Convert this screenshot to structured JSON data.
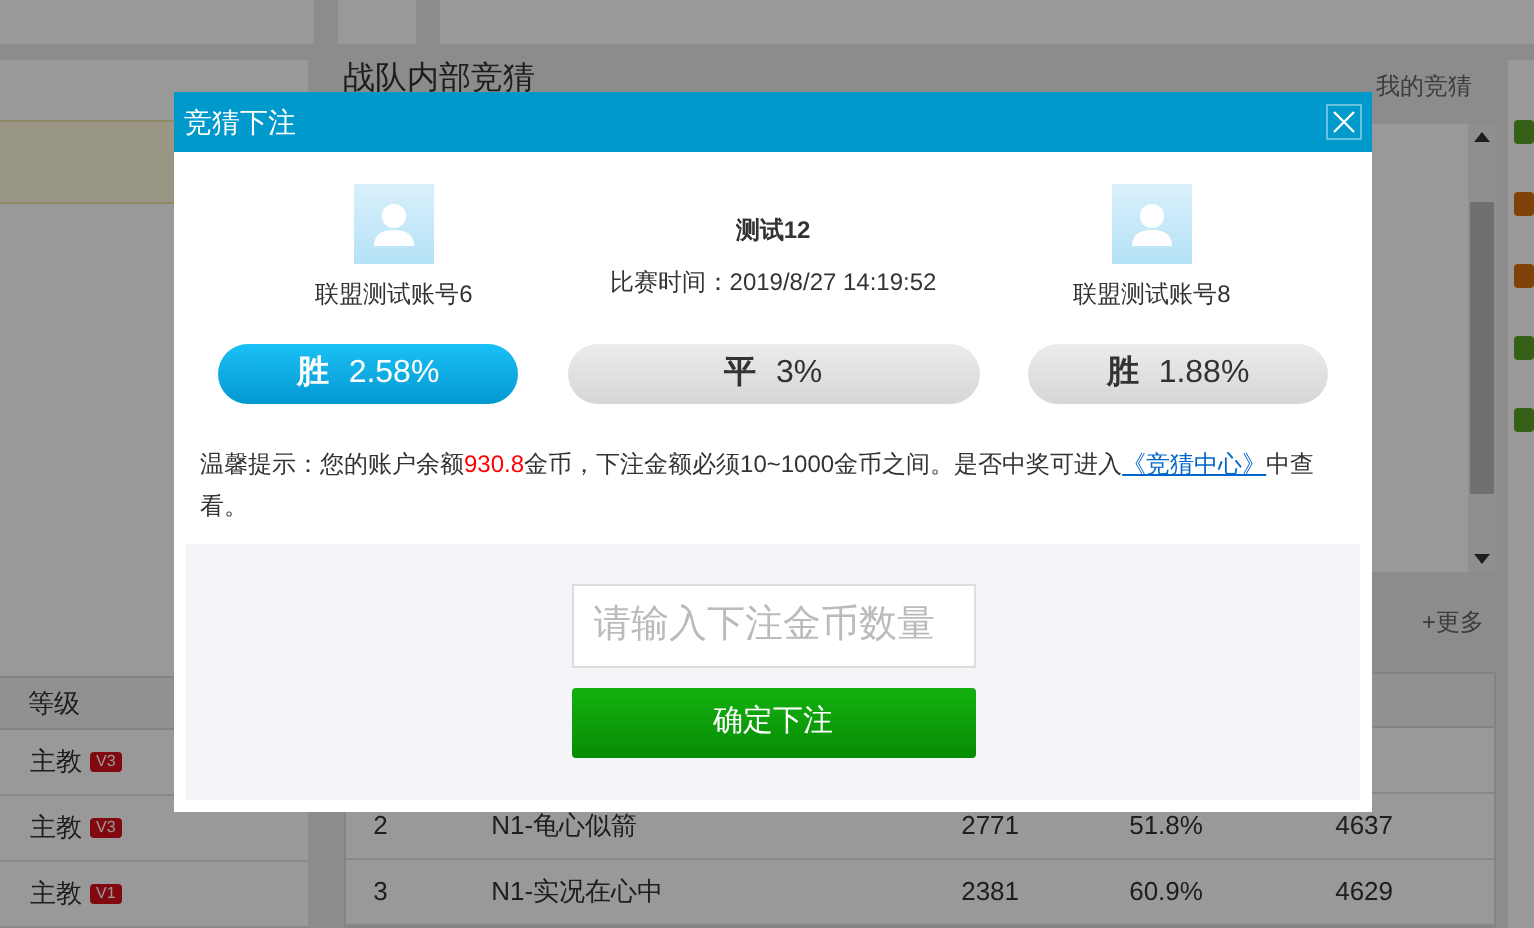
{
  "background": {
    "section_title": "战队内部竞猜",
    "my_bets_link": "我的竞猜",
    "more_link": "+更多",
    "level_header": "等级",
    "levels": [
      {
        "title": "主教",
        "badge": "V3"
      },
      {
        "title": "主教",
        "badge": "V3"
      },
      {
        "title": "主教",
        "badge": "V1"
      }
    ],
    "rows": [
      {
        "rank": "2",
        "name": "N1-龟心似箭",
        "column_3": "2771",
        "column_4": "51.8%",
        "column_5": "4637"
      },
      {
        "rank": "3",
        "name": "N1-实况在心中",
        "column_3": "2381",
        "column_4": "60.9%",
        "column_5": "4629"
      }
    ]
  },
  "dialog": {
    "title": "竞猜下注",
    "home": {
      "name": "联盟测试账号6"
    },
    "away": {
      "name": "联盟测试账号8"
    },
    "match": {
      "name": "测试12",
      "time": "比赛时间：2019/8/27 14:19:52"
    },
    "options": [
      {
        "label": "胜",
        "odds": "2.58%",
        "selected": true
      },
      {
        "label": "平",
        "odds": "3%",
        "selected": false
      },
      {
        "label": "胜",
        "odds": "1.88%",
        "selected": false
      }
    ],
    "hint": {
      "before": "温馨提示：您的账户余额",
      "amount": "930.8",
      "middle": "金币，下注金额必须10~1000金币之间。是否中奖可进入",
      "link": "《竞猜中心》",
      "after": "中查看。"
    },
    "amount_field": {
      "placeholder": "请输入下注金币数量"
    },
    "submit": "确定下注"
  }
}
